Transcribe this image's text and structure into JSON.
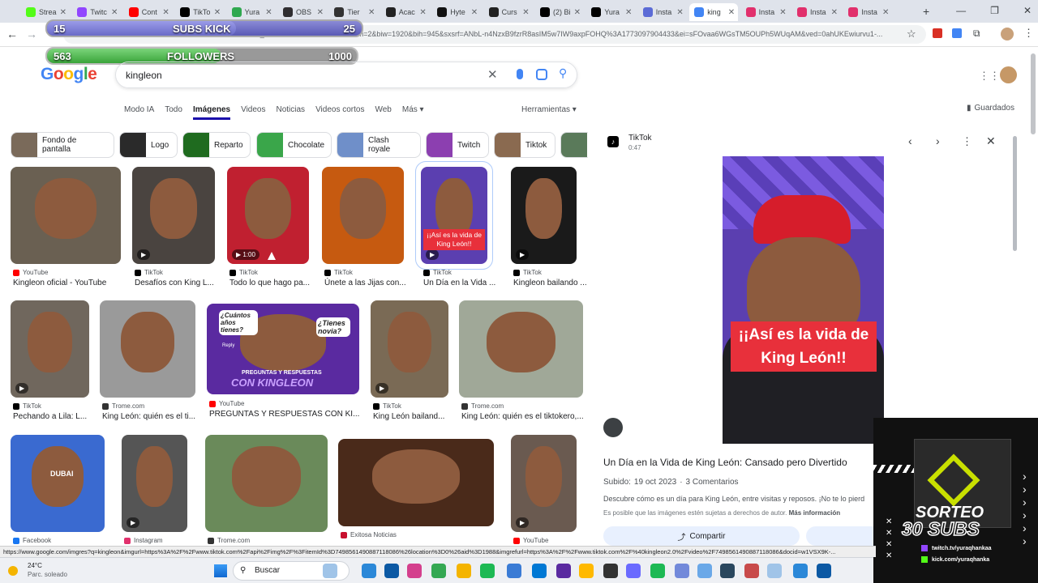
{
  "tabs": [
    {
      "label": "Strea",
      "color": "#53fc18"
    },
    {
      "label": "Twitc",
      "color": "#9146ff"
    },
    {
      "label": "Cont",
      "color": "#ff0000"
    },
    {
      "label": "TikTo",
      "color": "#000000"
    },
    {
      "label": "Yura",
      "color": "#2fa84f"
    },
    {
      "label": "OBS",
      "color": "#302e31"
    },
    {
      "label": "Tier",
      "color": "#333333"
    },
    {
      "label": "Acac",
      "color": "#222222"
    },
    {
      "label": "Hyte",
      "color": "#111111"
    },
    {
      "label": "Curs",
      "color": "#222222"
    },
    {
      "label": "(2) Bi",
      "color": "#000000"
    },
    {
      "label": "Yura",
      "color": "#000000"
    },
    {
      "label": "Insta",
      "color": "#5b6bd6"
    },
    {
      "label": "king",
      "color": "#4285f4"
    },
    {
      "label": "Insta",
      "color": "#e1306c"
    },
    {
      "label": "Insta",
      "color": "#e1306c"
    },
    {
      "label": "Insta",
      "color": "#e1306c"
    }
  ],
  "address": {
    "url": "w=1&sca_esv=87682ad47e04b72c&udm=2&biw=1920&bih=945&sxsrf=ANbL-n4NzxB9fzrR8asIM5w7IW9axpFOHQ%3A1773097904433&ei=sFOvaa6WGsTM5OUPh5WUqAM&ved=0ahUKEwiurvu1-..."
  },
  "overlay": {
    "subs_current": "15",
    "subs_label": "SUBS KICK",
    "subs_goal": "25",
    "subs_progress": 0.6,
    "followers_current": "563",
    "followers_label": "FOLLOWERS",
    "followers_goal": "1000",
    "followers_progress": 0.563
  },
  "google": {
    "logo": "Google",
    "query": "kingleon",
    "tabs": [
      "Modo IA",
      "Todo",
      "Imágenes",
      "Videos",
      "Noticias",
      "Videos cortos",
      "Web",
      "Más ▾"
    ],
    "tools": "Herramientas ▾",
    "saved": "Guardados"
  },
  "chips": [
    "Fondo de pantalla",
    "Logo",
    "Reparto",
    "Chocolate",
    "Clash royale",
    "Twitch",
    "Tiktok"
  ],
  "results": [
    {
      "source": "YouTube",
      "title": "Kingleon oficial - YouTube",
      "duration": ""
    },
    {
      "source": "TikTok",
      "title": "Desafíos con King L...",
      "duration": ""
    },
    {
      "source": "TikTok",
      "title": "Todo lo que hago pa...",
      "duration": "1:00"
    },
    {
      "source": "TikTok",
      "title": "Únete a las Jijas con...",
      "duration": ""
    },
    {
      "source": "TikTok",
      "title": "Un Día en la Vida ...",
      "duration": ""
    },
    {
      "source": "TikTok",
      "title": "Kingleon bailando ...",
      "duration": ""
    },
    {
      "source": "TikTok",
      "title": "Pechando a Lila: L...",
      "duration": ""
    },
    {
      "source": "Trome.com",
      "title": "King León: quién es el ti...",
      "duration": ""
    },
    {
      "source": "YouTube",
      "title": "PREGUNTAS Y RESPUESTAS CON KI...",
      "duration": ""
    },
    {
      "source": "TikTok",
      "title": "King León bailand...",
      "duration": ""
    },
    {
      "source": "Trome.com",
      "title": "King León: quién es el tiktokero,...",
      "duration": ""
    },
    {
      "source": "Facebook",
      "title": "",
      "duration": ""
    },
    {
      "source": "Instagram",
      "title": "",
      "duration": ""
    },
    {
      "source": "Trome.com",
      "title": "",
      "duration": ""
    },
    {
      "source": "Exitosa Noticias",
      "title": "",
      "duration": ""
    },
    {
      "source": "YouTube",
      "title": "",
      "duration": ""
    }
  ],
  "overlay_texts": {
    "banner": "¡¡Así es la vida de King León!!",
    "q1": "¿Cuántos años tienes?",
    "q2": "¿Tienes novia?",
    "reply": "Reply",
    "pyr": "PREGUNTAS Y RESPUESTAS",
    "con": "CON KINGLEON",
    "dubai": "DUBAI"
  },
  "panel": {
    "source": "TikTok",
    "duration": "0:47",
    "banner": "¡¡Así es la vida de King León!!",
    "title": "Un Día en la Vida de King León: Cansado pero Divertido",
    "uploaded_label": "Subido:",
    "uploaded_date": "19 oct 2023",
    "comments": "3 Comentarios",
    "description": "Descubre cómo es un día para King León, entre visitas y reposos. ¡No te lo pierd",
    "copyright": "Es posible que las imágenes estén sujetas a derechos de autor.",
    "more_info": "Más información",
    "share": "Compartir"
  },
  "sorteo": {
    "line1": "SORTEO",
    "line2": "30 SUBS",
    "twitch": "twitch.tv/yuraqhankaa",
    "kick": "kick.com/yuraqhanka"
  },
  "status_url": "https://www.google.com/imgres?q=kingleon&imgurl=https%3A%2F%2Fwww.tiktok.com%2Fapi%2Fimg%2F%3FitemId%3D7498561490887118086%26location%3D0%26aid%3D1988&imgrefurl=https%3A%2F%2Fwww.tiktok.com%2F%40kingleon2.0%2Fvideo%2F7498561490887118086&docid=w1VSX9K-...",
  "taskbar": {
    "temp": "24°C",
    "weather": "Parc. soleado",
    "search": "Buscar"
  }
}
